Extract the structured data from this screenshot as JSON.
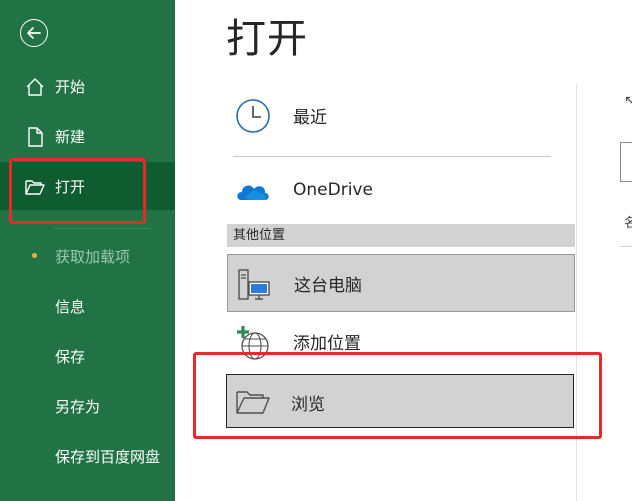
{
  "page": {
    "title": "打开"
  },
  "nav": {
    "items": [
      {
        "label": "开始"
      },
      {
        "label": "新建"
      },
      {
        "label": "打开"
      },
      {
        "label": "获取加载项"
      },
      {
        "label": "信息"
      },
      {
        "label": "保存"
      },
      {
        "label": "另存为"
      },
      {
        "label": "保存到百度网盘"
      }
    ]
  },
  "locations": {
    "recent": "最近",
    "onedrive": "OneDrive",
    "section_other": "其他位置",
    "this_pc": "这台电脑",
    "add_place": "添加位置",
    "browse": "浏览"
  },
  "right_panel": {
    "column_label": "名"
  },
  "colors": {
    "nav_bg": "#217346",
    "nav_active": "#0e5c2f",
    "highlight": "#e8282b",
    "selected_bg": "#d2d2d2"
  }
}
